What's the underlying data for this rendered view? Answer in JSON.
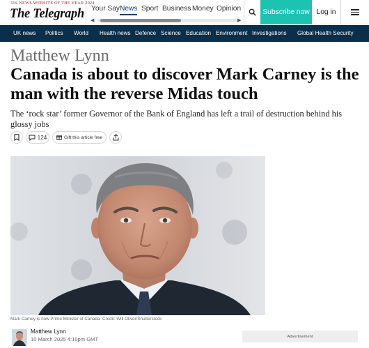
{
  "header": {
    "award_text": "UK NEWS WEBSITE OF THE YEAR 2024",
    "logo_text": "The Telegraph",
    "tabs": [
      {
        "label": "Your Say",
        "active": false
      },
      {
        "label": "News",
        "active": true
      },
      {
        "label": "Sport",
        "active": false
      },
      {
        "label": "Business",
        "active": false
      },
      {
        "label": "Money",
        "active": false
      },
      {
        "label": "Opinion",
        "active": false
      }
    ],
    "search_icon": "search-icon",
    "subscribe_label": "Subscribe now",
    "login_label": "Log in",
    "menu_icon": "hamburger-menu-icon",
    "accent_color": "#1dc3b2"
  },
  "section_nav": {
    "background_color": "#0b2e4a",
    "items": [
      "UK news",
      "Politics",
      "World",
      "Health news",
      "Defence",
      "Science",
      "Education",
      "Environment",
      "Investigations",
      "Global Health Security"
    ]
  },
  "article": {
    "author_kicker": "Matthew Lynn",
    "headline": "Canada is about to discover Mark Carney is the man with the reverse Midas touch",
    "standfirst": "The ‘rock star’ former Governor of the Bank of England has left a trail of destruction behind his glossy jobs",
    "actions": {
      "bookmark_icon": "bookmark-icon",
      "comments_icon": "comment-icon",
      "comment_count": "124",
      "gift_icon": "gift-icon",
      "gift_label": "Gift this article free",
      "share_icon": "share-icon"
    },
    "image": {
      "caption": "Mark Carney is now Prime Minister of Canada",
      "credit": "Credit: Will Oliver/Shutterstock"
    },
    "byline": {
      "name": "Matthew Lynn",
      "date": "10 March 2025 4:10pm GMT"
    }
  },
  "advertisement": {
    "label": "Advertisement"
  }
}
